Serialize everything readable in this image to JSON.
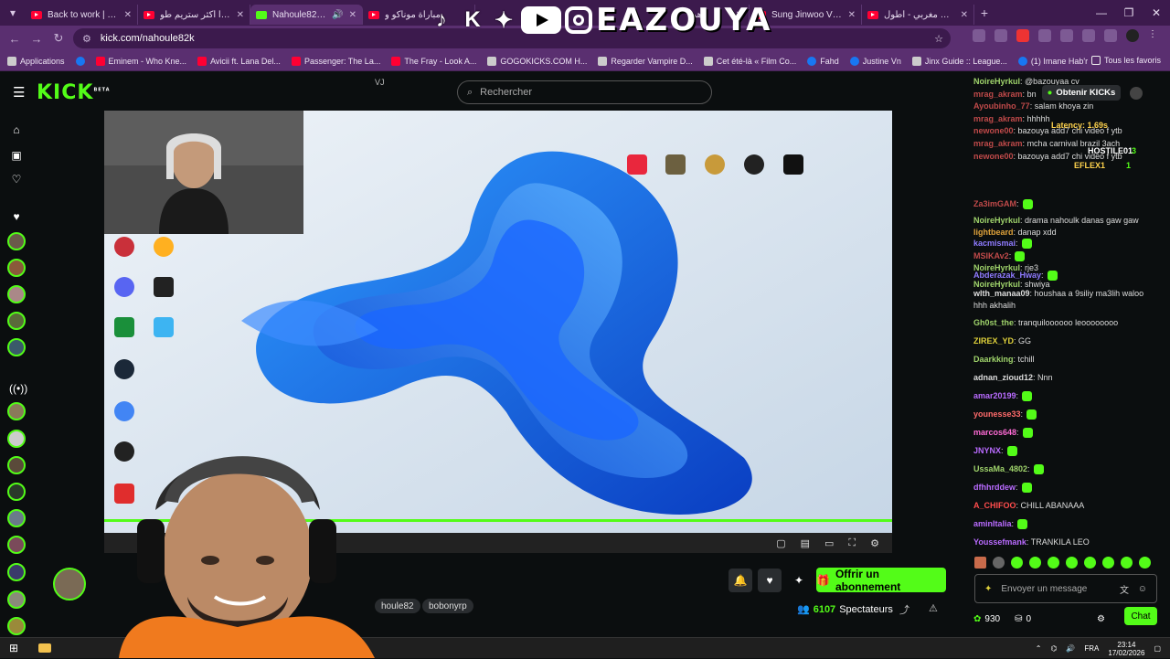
{
  "browser": {
    "tabs": [
      {
        "title": "Back to work | Trainin",
        "icon": "youtube",
        "active": false
      },
      {
        "title": "هاذا أكثر ستريم طو",
        "icon": "youtube",
        "active": false
      },
      {
        "title": "Nahoule82k Strea",
        "icon": "kick",
        "active": true
      },
      {
        "title": "مباراة موناكو و",
        "icon": "youtube",
        "active": false
      },
      {
        "title": "أهم",
        "icon": "youtube",
        "active": false
      },
      {
        "title": "Sung Jinwoo VS Karg",
        "icon": "youtube",
        "active": false
      },
      {
        "title": "عملاق مغربي - أطول",
        "icon": "youtube",
        "active": false
      }
    ],
    "url": "kick.com/nahoule82k",
    "bookmarks": [
      {
        "label": "Applications",
        "icon": "apps"
      },
      {
        "label": "",
        "icon": "facebook"
      },
      {
        "label": "Eminem - Who Kne...",
        "icon": "youtube"
      },
      {
        "label": "Avicii ft. Lana Del...",
        "icon": "youtube"
      },
      {
        "label": "Passenger: The La...",
        "icon": "youtube"
      },
      {
        "label": "The Fray - Look A...",
        "icon": "youtube"
      },
      {
        "label": "GOGOKICKS.COM H...",
        "icon": "site"
      },
      {
        "label": "Regarder Vampire D...",
        "icon": "site"
      },
      {
        "label": "Cet été-là « Film Co...",
        "icon": "site"
      },
      {
        "label": "Fahd",
        "icon": "facebook"
      },
      {
        "label": "Justine Vn",
        "icon": "facebook"
      },
      {
        "label": "Jinx Guide :: League...",
        "icon": "site"
      },
      {
        "label": "(1) Imane Hab'r",
        "icon": "facebook"
      }
    ],
    "all_bookmarks": "Tous les favoris"
  },
  "overlay": {
    "brand_name": "EAZOUYA",
    "brand_chars": [
      "♪",
      "K",
      "✦"
    ]
  },
  "kick": {
    "logo": "KICK",
    "logo_sup": "BETA",
    "search_placeholder": "Rechercher",
    "small_tag": "VJ",
    "obtain_kicks": "Obtenir KICKs",
    "subscribe_label": "Offrir un abonnement",
    "tags": [
      "houle82",
      "bobonyrp"
    ],
    "viewer_count": "6107",
    "viewers_label": "Spectateurs",
    "chat_placeholder": "Envoyer un message",
    "chat_points": "930",
    "chat_zero": "0",
    "chat_button": "Chat",
    "accent": "#53fc18"
  },
  "video_overlay": {
    "latency": "Latency: 1.69s",
    "host": "HOSTILE01",
    "flex": "EFLEX1",
    "count1": "3",
    "count2": "1"
  },
  "chat": [
    {
      "user": "NoireHyrkul",
      "color": "#9fd36b",
      "text": "@bazouyaa cv"
    },
    {
      "user": "mrag_akram",
      "color": "#c04a4a",
      "text": "bn"
    },
    {
      "user": "Ayoubinho_77",
      "color": "#c04a4a",
      "text": "salam khoya zin"
    },
    {
      "user": "mrag_akram",
      "color": "#c04a4a",
      "text": "hhhhh"
    },
    {
      "user": "newone00",
      "color": "#c04a4a",
      "text": "bazouya add7 chi video f ytb"
    },
    {
      "user": "mrag_akram",
      "color": "#c04a4a",
      "text": "mcha carnival brazil 3ach"
    },
    {
      "user": "newone00",
      "color": "#c04a4a",
      "text": "bazouya add7 chi video f ytb"
    },
    {
      "user": "Za3imGAM",
      "color": "#c04a4a",
      "text": ""
    },
    {
      "user": "NoireHyrkul",
      "color": "#9fd36b",
      "text": "drama nahoulk danas gaw gaw"
    },
    {
      "user": "lightbeard",
      "color": "#e0a33b",
      "text": "danap xdd"
    },
    {
      "user": "kacmismai",
      "color": "#8f7bff",
      "text": ""
    },
    {
      "user": "MSIKAv2",
      "color": "#c04a4a",
      "text": ""
    },
    {
      "user": "NoireHyrkul",
      "color": "#9fd36b",
      "text": "rje3"
    },
    {
      "user": "Abderazak_Hway",
      "color": "#8f7bff",
      "text": ""
    },
    {
      "user": "NoireHyrkul",
      "color": "#9fd36b",
      "text": "shwiya"
    },
    {
      "user": "wlth_manaa09",
      "color": "#ddd",
      "text": "houshaa a 9siliy ma3lih waloo"
    },
    {
      "user": "",
      "color": "#ddd",
      "text": "hhh akhalih"
    },
    {
      "user": "Gh0st_the",
      "color": "#9fd36b",
      "text": "tranquiloooooo leoooooooo"
    },
    {
      "user": "ZIREX_YD",
      "color": "#e0d23b",
      "text": "GG"
    },
    {
      "user": "Daarkking",
      "color": "#9fd36b",
      "text": "tchill"
    },
    {
      "user": "adnan_zioud12",
      "color": "#ddd",
      "text": "Nnn"
    },
    {
      "user": "amar20199",
      "color": "#b96bff",
      "text": ""
    },
    {
      "user": "younesse33",
      "color": "#ff6b6b",
      "text": ""
    },
    {
      "user": "marcos648",
      "color": "#ff6bd6",
      "text": ""
    },
    {
      "user": "JNYNX",
      "color": "#b96bff",
      "text": ""
    },
    {
      "user": "UssaMa_4802",
      "color": "#9fd36b",
      "text": ""
    },
    {
      "user": "dfhhrddew",
      "color": "#b96bff",
      "text": ""
    },
    {
      "user": "A_CHIFOO",
      "color": "#ff4d4d",
      "text": "CHILL ABANAAA"
    },
    {
      "user": "aminItalia",
      "color": "#b96bff",
      "text": ""
    },
    {
      "user": "Youssefmank",
      "color": "#b96bff",
      "text": "TRANKILA LEO"
    }
  ],
  "taskbar": {
    "lang": "FRA",
    "time": "23:14",
    "date": "17/02/2026"
  }
}
